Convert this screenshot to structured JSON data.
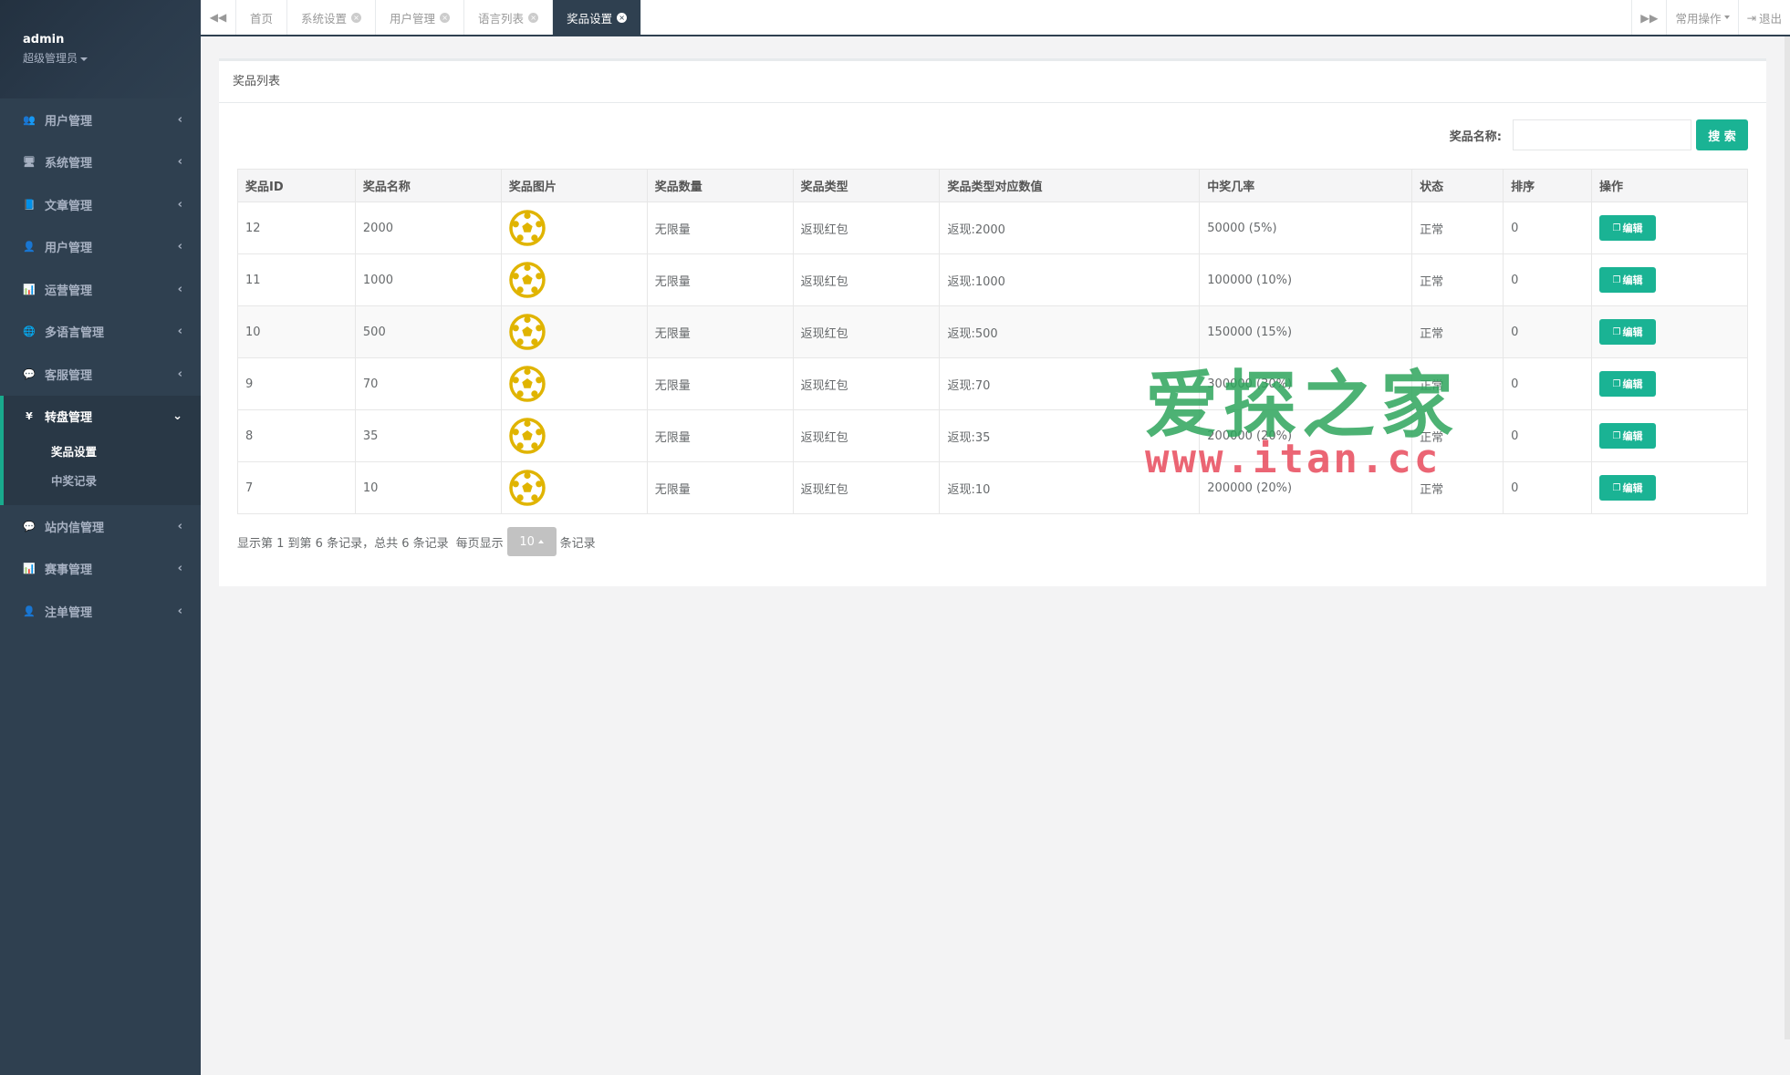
{
  "profile": {
    "name": "admin",
    "role": "超级管理员"
  },
  "sidebar": {
    "groups": [
      {
        "icon": "👥",
        "label": "用户管理"
      },
      {
        "icon": "🖥",
        "label": "系统管理"
      },
      {
        "icon": "📘",
        "label": "文章管理"
      },
      {
        "icon": "👤",
        "label": "用户管理"
      },
      {
        "icon": "📊",
        "label": "运营管理"
      },
      {
        "icon": "🌐",
        "label": "多语言管理"
      },
      {
        "icon": "💬",
        "label": "客服管理"
      }
    ],
    "active_group": {
      "icon": "¥",
      "label": "转盘管理",
      "sub": [
        "奖品设置",
        "中奖记录"
      ]
    },
    "groups_after": [
      {
        "icon": "💬",
        "label": "站内信管理"
      },
      {
        "icon": "📊",
        "label": "赛事管理"
      },
      {
        "icon": "👤",
        "label": "注单管理"
      }
    ]
  },
  "tabs": [
    "首页",
    "系统设置",
    "用户管理",
    "语言列表",
    "奖品设置"
  ],
  "toolbar": {
    "common_ops": "常用操作",
    "logout": "退出"
  },
  "panel": {
    "title": "奖品列表",
    "search_label": "奖品名称:",
    "search_button": "搜 索",
    "search_placeholder": ""
  },
  "table": {
    "headers": [
      "奖品ID",
      "奖品名称",
      "奖品图片",
      "奖品数量",
      "奖品类型",
      "奖品类型对应数值",
      "中奖几率",
      "状态",
      "排序",
      "操作"
    ],
    "rows": [
      {
        "id": "12",
        "name": "2000",
        "qty": "无限量",
        "type": "返现红包",
        "value": "返现:2000",
        "rate": "50000 (5%)",
        "status": "正常",
        "sort": "0"
      },
      {
        "id": "11",
        "name": "1000",
        "qty": "无限量",
        "type": "返现红包",
        "value": "返现:1000",
        "rate": "100000 (10%)",
        "status": "正常",
        "sort": "0"
      },
      {
        "id": "10",
        "name": "500",
        "qty": "无限量",
        "type": "返现红包",
        "value": "返现:500",
        "rate": "150000 (15%)",
        "status": "正常",
        "sort": "0"
      },
      {
        "id": "9",
        "name": "70",
        "qty": "无限量",
        "type": "返现红包",
        "value": "返现:70",
        "rate": "300000 (30%)",
        "status": "正常",
        "sort": "0"
      },
      {
        "id": "8",
        "name": "35",
        "qty": "无限量",
        "type": "返现红包",
        "value": "返现:35",
        "rate": "200000 (20%)",
        "status": "正常",
        "sort": "0"
      },
      {
        "id": "7",
        "name": "10",
        "qty": "无限量",
        "type": "返现红包",
        "value": "返现:10",
        "rate": "200000 (20%)",
        "status": "正常",
        "sort": "0"
      }
    ],
    "edit_label": "编辑"
  },
  "pager": {
    "summary": "显示第 1 到第 6 条记录，总共 6 条记录",
    "per_page_prefix": "每页显示",
    "per_page": "10",
    "per_page_suffix": "条记录"
  },
  "watermark": {
    "cn": "爱探之家",
    "url": "www.itan.cc"
  },
  "colors": {
    "sidebar": "#2f4050",
    "accent": "#1ab394",
    "ball": "#e0b400"
  }
}
